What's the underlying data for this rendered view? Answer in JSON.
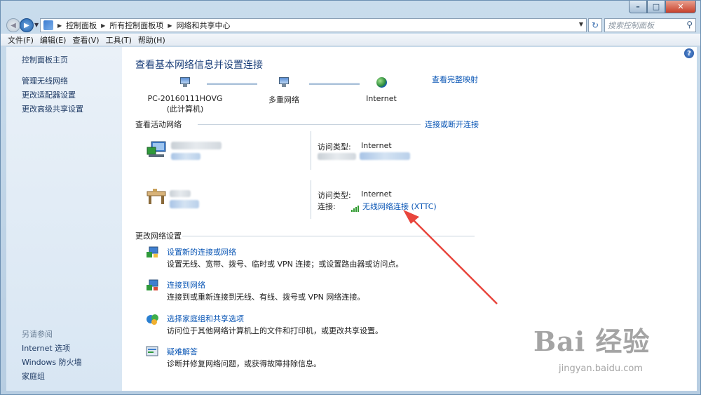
{
  "titlebar": {
    "faint_text": ""
  },
  "address": {
    "crumbs": [
      "控制面板",
      "所有控制面板项",
      "网络和共享中心"
    ],
    "search_placeholder": "搜索控制面板"
  },
  "menu": [
    "文件(F)",
    "编辑(E)",
    "查看(V)",
    "工具(T)",
    "帮助(H)"
  ],
  "sidebar": {
    "home": "控制面板主页",
    "items": [
      "管理无线网络",
      "更改适配器设置",
      "更改高级共享设置"
    ],
    "see_also_title": "另请参阅",
    "see_also": [
      "Internet 选项",
      "Windows 防火墙",
      "家庭组"
    ]
  },
  "main": {
    "title": "查看基本网络信息并设置连接",
    "full_map": "查看完整映射",
    "map": {
      "pc_name": "PC-20160111HOVG",
      "pc_sub": "(此计算机)",
      "middle": "多重网络",
      "right": "Internet"
    },
    "active": {
      "heading": "查看活动网络",
      "connect_link": "连接或断开连接",
      "net1": {
        "access_label": "访问类型:",
        "access_value": "Internet"
      },
      "net2": {
        "access_label": "访问类型:",
        "access_value": "Internet",
        "conn_label": "连接:",
        "conn_value": "无线网络连接 (XTTC)"
      }
    },
    "change": {
      "heading": "更改网络设置",
      "tasks": [
        {
          "link": "设置新的连接或网络",
          "desc": "设置无线、宽带、拨号、临时或 VPN 连接；或设置路由器或访问点。"
        },
        {
          "link": "连接到网络",
          "desc": "连接到或重新连接到无线、有线、拨号或 VPN 网络连接。"
        },
        {
          "link": "选择家庭组和共享选项",
          "desc": "访问位于其他网络计算机上的文件和打印机，或更改共享设置。"
        },
        {
          "link": "疑难解答",
          "desc": "诊断并修复网络问题，或获得故障排除信息。"
        }
      ]
    }
  },
  "watermark": {
    "logo": "Bai 经验",
    "url": "jingyan.baidu.com"
  },
  "colors": {
    "link": "#0a56b5",
    "title": "#1a3e79",
    "arrow": "#e8453c"
  }
}
